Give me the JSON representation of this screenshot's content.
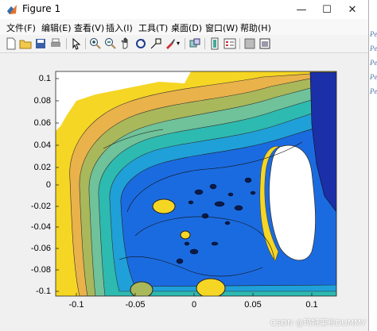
{
  "window": {
    "title": "Figure 1",
    "minimize_glyph": "—",
    "maximize_glyph": "☐",
    "close_glyph": "✕"
  },
  "menu": [
    {
      "label": "文件(F)"
    },
    {
      "label": "编辑(E)"
    },
    {
      "label": "查看(V)"
    },
    {
      "label": "插入(I)"
    },
    {
      "label": "工具(T)"
    },
    {
      "label": "桌面(D)"
    },
    {
      "label": "窗口(W)"
    },
    {
      "label": "帮助(H)"
    }
  ],
  "toolbar_icons": [
    "new-figure-icon",
    "open-icon",
    "save-icon",
    "print-icon",
    "pointer-icon",
    "zoom-in-icon",
    "zoom-out-icon",
    "pan-icon",
    "rotate-icon",
    "data-cursor-icon",
    "brush-icon",
    "link-icon",
    "colorbar-icon",
    "legend-icon",
    "hide-tools-icon",
    "dock-icon"
  ],
  "chart_data": {
    "type": "heatmap",
    "description_kind": "filled contour map",
    "x_ticks": [
      "-0.1",
      "-0.05",
      "0",
      "0.05",
      "0.1"
    ],
    "y_ticks": [
      "0.1",
      "0.08",
      "0.06",
      "0.04",
      "0.02",
      "0",
      "-0.02",
      "-0.04",
      "-0.06",
      "-0.08",
      "-0.1"
    ],
    "xlim": [
      -0.12,
      0.12
    ],
    "ylim": [
      -0.105,
      0.105
    ],
    "colormap": [
      "#1a2fa8",
      "#1b6be0",
      "#1fa0d8",
      "#26b8b0",
      "#7bc08a",
      "#c0b850",
      "#f2d41c",
      "#ffffff"
    ],
    "grid": false
  },
  "side_strip": [
    "Pe",
    "Pe",
    "Pe",
    "Pe",
    "Pe"
  ],
  "watermark": "CSDN @玛特莱布DUMMY"
}
